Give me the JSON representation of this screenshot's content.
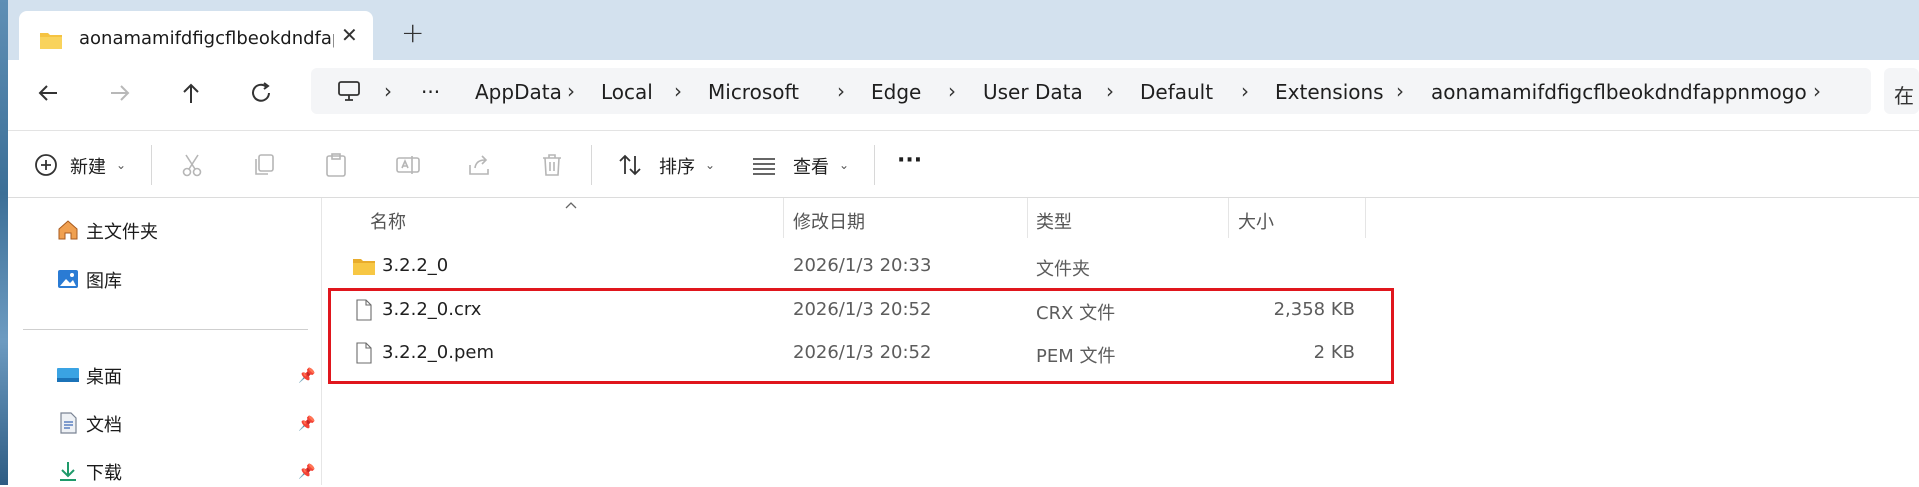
{
  "window": {
    "tab_title": "aonamamifdfigcflbeokdndfappnmogo",
    "tab_close": "✕",
    "new_tab": "+"
  },
  "address": {
    "more": "···",
    "segments": [
      "AppData",
      "Local",
      "Microsoft",
      "Edge",
      "User Data",
      "Default",
      "Extensions",
      "aonamamifdfigcflbeokdndfappnmogo"
    ],
    "separator": "›",
    "search_prefix": "在"
  },
  "toolbar": {
    "new_label": "新建",
    "sort_label": "排序",
    "view_label": "查看",
    "more": "···",
    "chevron": "⌄"
  },
  "sidebar": {
    "items": [
      {
        "label": "主文件夹",
        "icon": "home-icon"
      },
      {
        "label": "图库",
        "icon": "gallery-icon"
      },
      {
        "label": "桌面",
        "icon": "desktop-icon",
        "pinned": true
      },
      {
        "label": "文档",
        "icon": "document-icon",
        "pinned": true
      },
      {
        "label": "下载",
        "icon": "download-icon",
        "pinned": true
      }
    ]
  },
  "columns": {
    "name": "名称",
    "modified": "修改日期",
    "type": "类型",
    "size": "大小"
  },
  "files": [
    {
      "name": "3.2.2_0",
      "modified": "2026/1/3 20:33",
      "type": "文件夹",
      "size": "",
      "icon": "folder-icon"
    },
    {
      "name": "3.2.2_0.crx",
      "modified": "2026/1/3 20:52",
      "type": "CRX 文件",
      "size": "2,358 KB",
      "icon": "file-icon"
    },
    {
      "name": "3.2.2_0.pem",
      "modified": "2026/1/3 20:52",
      "type": "PEM 文件",
      "size": "2 KB",
      "icon": "file-icon"
    }
  ],
  "colors": {
    "highlight": "#e0161d",
    "folder": "#f5c342",
    "accent": "#1f6fc5"
  }
}
